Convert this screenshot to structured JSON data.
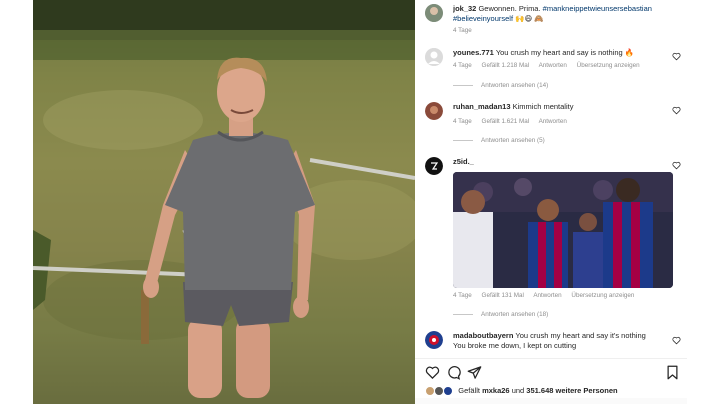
{
  "post": {
    "author": "jok_32",
    "caption_text": "Gewonnen. Prima.",
    "hashtags": "#mankneippetwieunsersebastian",
    "hashtags2": "#believeinyourself",
    "emoji": "🙌😄 🙈",
    "age": "4 Tage"
  },
  "comments": [
    {
      "user": "younes.771",
      "text": "You crush my heart and say is nothing 🔥",
      "age": "4 Tage",
      "likes": "Gefällt 1.218 Mal",
      "reply": "Antworten",
      "translate": "Übersetzung anzeigen",
      "view_replies": "Antworten ansehen (14)"
    },
    {
      "user": "ruhan_madan13",
      "text": "Kimmich mentality",
      "age": "4 Tage",
      "likes": "Gefällt 1.621 Mal",
      "reply": "Antworten",
      "view_replies": "Antworten ansehen (5)"
    },
    {
      "user": "z5id._",
      "text": "",
      "age": "4 Tage",
      "likes": "Gefällt 131 Mal",
      "reply": "Antworten",
      "translate": "Übersetzung anzeigen",
      "view_replies": "Antworten ansehen (18)"
    },
    {
      "user": "madaboutbayern",
      "text": "You crush my heart and say it's nothing",
      "text2": "You broke me down, I kept on cutting"
    }
  ],
  "footer": {
    "liked_by_prefix": "Gefällt",
    "liked_by_user": "mxka26",
    "liked_by_mid": "und",
    "liked_by_count": "351.648 weitere Personen"
  },
  "colors": {
    "text": "#262626",
    "muted": "#8e8e8e",
    "link": "#00376b",
    "barca_blue": "#1c3a8a",
    "barca_red": "#a50044"
  },
  "icons": [
    "heart-icon",
    "comment-icon",
    "share-icon",
    "bookmark-icon"
  ]
}
